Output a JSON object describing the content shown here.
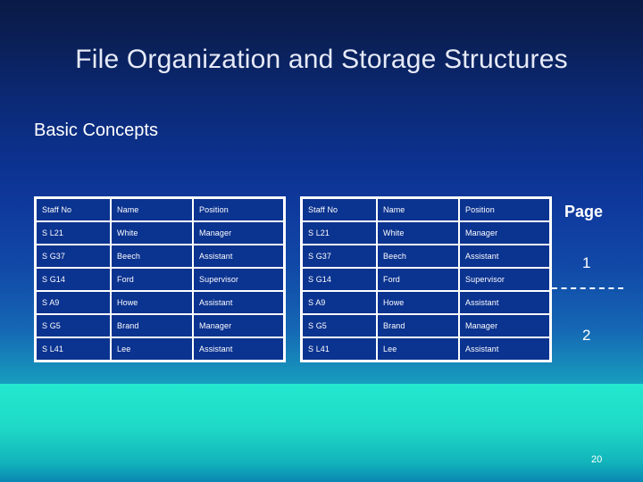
{
  "slide": {
    "title": "File Organization and Storage Structures",
    "subtitle": "Basic Concepts",
    "slide_number": "20",
    "colors": {
      "background_top": "#0a1a46",
      "background_mid": "#0f3a9e",
      "background_bottom": "#1ae0cc",
      "table_cell": "#0b3390",
      "table_border": "#ffffff",
      "title_text": "#e6eaf7",
      "mountain_light": "#a08471",
      "mountain_dark": "#4a3420"
    }
  },
  "annotations": {
    "page_label": "Page",
    "page_1": "1",
    "page_2": "2",
    "divider_icon": "dashed-line-icon"
  },
  "tables": [
    {
      "name": "staff-table-left",
      "columns": [
        "Staff No",
        "Name",
        "Position"
      ],
      "rows": [
        [
          "S L21",
          "White",
          "Manager"
        ],
        [
          "S G37",
          "Beech",
          "Assistant"
        ],
        [
          "S G14",
          "Ford",
          "Supervisor"
        ],
        [
          "S A9",
          "Howe",
          "Assistant"
        ],
        [
          "S G5",
          "Brand",
          "Manager"
        ],
        [
          "S L41",
          "Lee",
          "Assistant"
        ]
      ]
    },
    {
      "name": "staff-table-right",
      "columns": [
        "Staff No",
        "Name",
        "Position"
      ],
      "rows": [
        [
          "S L21",
          "White",
          "Manager"
        ],
        [
          "S G37",
          "Beech",
          "Assistant"
        ],
        [
          "S G14",
          "Ford",
          "Supervisor"
        ],
        [
          "S A9",
          "Howe",
          "Assistant"
        ],
        [
          "S G5",
          "Brand",
          "Manager"
        ],
        [
          "S L41",
          "Lee",
          "Assistant"
        ]
      ]
    }
  ]
}
